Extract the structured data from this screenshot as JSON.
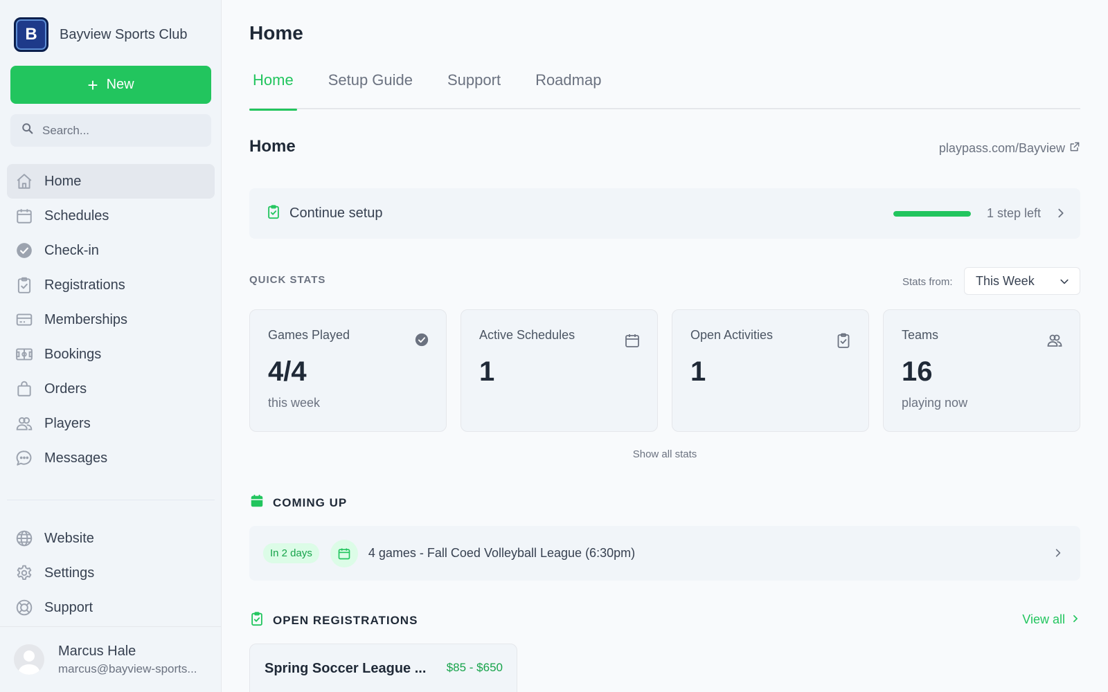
{
  "sidebar": {
    "brand": {
      "initial": "B",
      "name": "Bayview Sports Club"
    },
    "new_label": "New",
    "search": {
      "placeholder": "Search..."
    },
    "items": [
      {
        "label": "Home",
        "icon": "home-icon"
      },
      {
        "label": "Schedules",
        "icon": "calendar-icon"
      },
      {
        "label": "Check-in",
        "icon": "check-circle-icon"
      },
      {
        "label": "Registrations",
        "icon": "clipboard-check-icon"
      },
      {
        "label": "Memberships",
        "icon": "card-icon"
      },
      {
        "label": "Bookings",
        "icon": "field-icon"
      },
      {
        "label": "Orders",
        "icon": "bag-icon"
      },
      {
        "label": "Players",
        "icon": "users-icon"
      },
      {
        "label": "Messages",
        "icon": "chat-icon"
      }
    ],
    "secondary": [
      {
        "label": "Website",
        "icon": "globe-icon"
      },
      {
        "label": "Settings",
        "icon": "gear-icon"
      },
      {
        "label": "Support",
        "icon": "lifebuoy-icon"
      }
    ],
    "user": {
      "name": "Marcus Hale",
      "email": "marcus@bayview-sports..."
    }
  },
  "header": {
    "title": "Home",
    "tabs": [
      {
        "label": "Home"
      },
      {
        "label": "Setup Guide"
      },
      {
        "label": "Support"
      },
      {
        "label": "Roadmap"
      }
    ]
  },
  "home": {
    "title": "Home",
    "site_link": "playpass.com/Bayview",
    "setup": {
      "label": "Continue setup",
      "progress_fraction": 1.0,
      "steps_left": "1 step left"
    },
    "quick_stats": {
      "title": "QUICK STATS",
      "stats_from_label": "Stats from:",
      "period": "This Week",
      "cards": [
        {
          "label": "Games Played",
          "value": "4/4",
          "sub": "this week",
          "icon": "check-circle-icon"
        },
        {
          "label": "Active Schedules",
          "value": "1",
          "sub": "",
          "icon": "calendar-icon"
        },
        {
          "label": "Open Activities",
          "value": "1",
          "sub": "",
          "icon": "clipboard-check-icon"
        },
        {
          "label": "Teams",
          "value": "16",
          "sub": "playing now",
          "icon": "users-icon"
        }
      ],
      "show_all": "Show all stats"
    },
    "coming_up": {
      "title": "COMING UP",
      "event": {
        "badge": "In 2 days",
        "label": "4 games - Fall Coed Volleyball League (6:30pm)"
      }
    },
    "open_registrations": {
      "title": "OPEN REGISTRATIONS",
      "view_all": "View all",
      "items": [
        {
          "name": "Spring Soccer League ...",
          "price": "$85 - $650"
        }
      ]
    }
  },
  "colors": {
    "accent": "#22c55e",
    "brand": "#1e3a8a"
  }
}
